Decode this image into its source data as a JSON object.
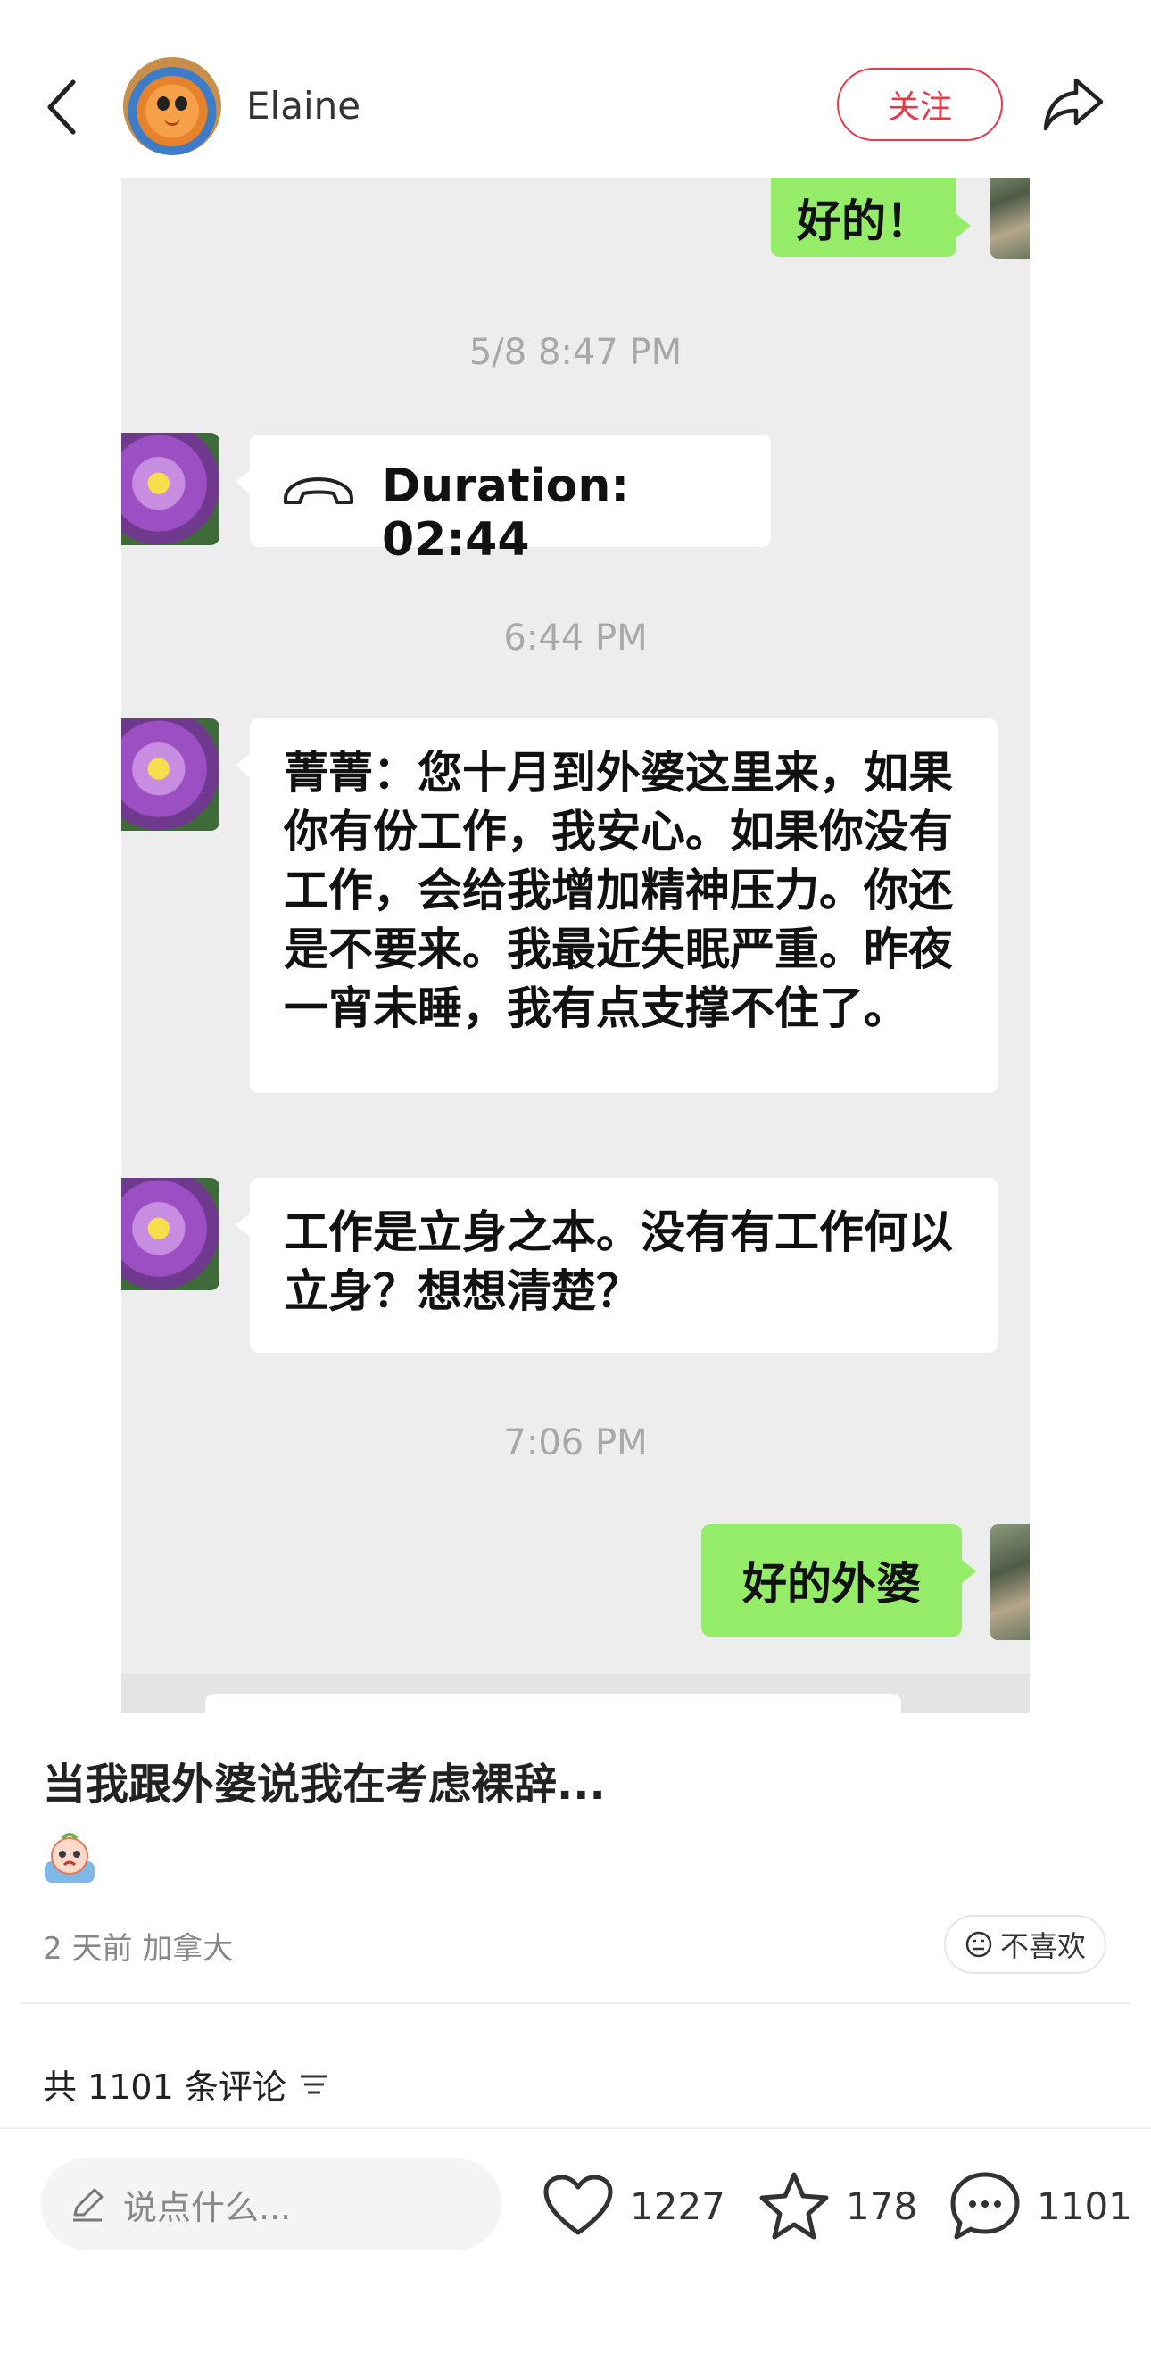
{
  "header": {
    "username": "Elaine",
    "follow_label": "关注"
  },
  "chat": {
    "top_bubble": "好的！",
    "time1": "5/8 8:47 PM",
    "call_text": "Duration: 02:44",
    "time2": "6:44 PM",
    "msg1": "菁菁：您十月到外婆这里来，如果你有份工作，我安心。如果你没有工作，会给我增加精神压力。你还是不要来。我最近失眠严重。昨夜一宵未睡，我有点支撑不住了。",
    "msg2": "工作是立身之本。没有有工作何以立身？想想清楚？",
    "time3": "7:06 PM",
    "reply": "好的外婆"
  },
  "post": {
    "title": "当我跟外婆说我在考虑裸辞...",
    "meta": "2 天前 加拿大",
    "dislike_label": "不喜欢",
    "comments_summary": "共 1101 条评论"
  },
  "bottom": {
    "input_placeholder": "说点什么...",
    "likes": "1227",
    "stars": "178",
    "comments": "1101"
  },
  "colors": {
    "accent_red": "#e8394a",
    "wechat_green": "#95ec69",
    "chat_bg": "#ededed"
  }
}
